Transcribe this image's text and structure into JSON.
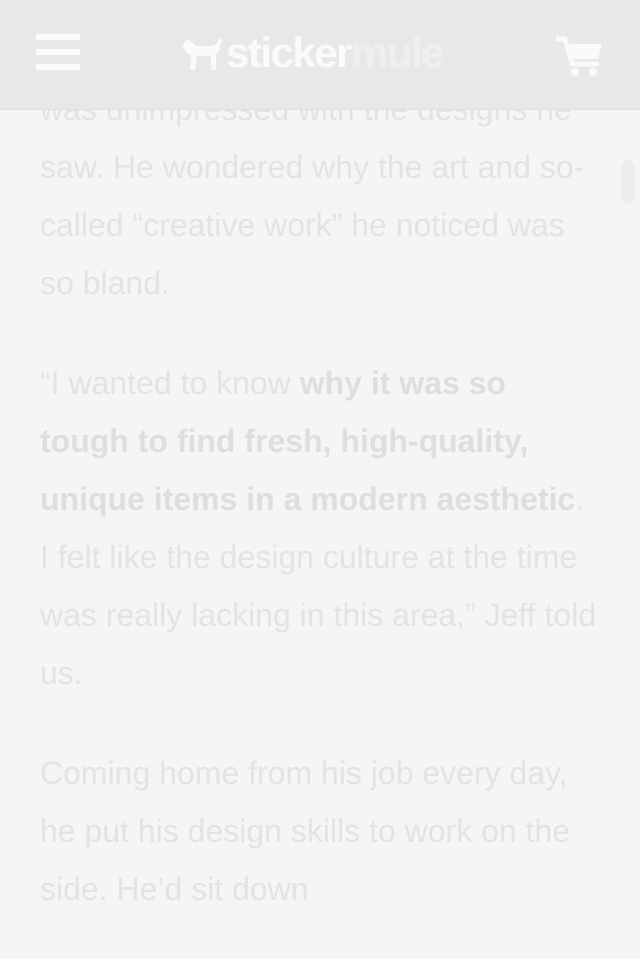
{
  "header": {
    "logo": {
      "word1": "sticker",
      "word2": "mule"
    },
    "menu_icon": "hamburger-menu-icon",
    "cart_icon": "shopping-cart-icon"
  },
  "article": {
    "p1": "was unimpressed with the designs he saw. He wondered why the art and so-called “creative work” he noticed was so bland.",
    "p2_before": "“I wanted to know ",
    "p2_bold": "why it was so tough to find fresh, high-quality, unique items in a modern aesthetic",
    "p2_after": ". I felt like the design culture at the time was really lacking in this area,” Jeff told us.",
    "p3": "Coming home from his job every day, he put his design skills to work on the side. He’d sit down"
  },
  "colors": {
    "header_bg": "#e8e8e8",
    "page_bg": "#f5f5f5",
    "text": "#e3e3e3",
    "icon": "#fafafa"
  }
}
